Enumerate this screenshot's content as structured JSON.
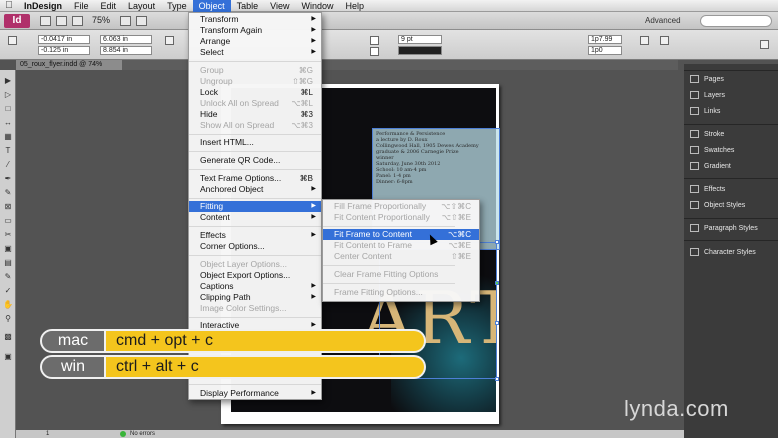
{
  "menubar": {
    "apple": "",
    "items": [
      "InDesign",
      "File",
      "Edit",
      "Layout",
      "Type",
      "Object",
      "Table",
      "View",
      "Window",
      "Help"
    ],
    "active": "Object"
  },
  "appbar": {
    "logo": "Id",
    "zoom": "75%",
    "workspace": "Advanced",
    "search_placeholder": ""
  },
  "control": {
    "x": "-0.0417 in",
    "y": "-0.125 in",
    "w": "6.063 in",
    "h": "8.854 in",
    "stroke": "9 pt",
    "ref": "1p0",
    "offset": "1p7.99"
  },
  "document": {
    "tab_title": "05_roux_flyer.indd @ 74%"
  },
  "object_menu": {
    "items": [
      {
        "label": "Transform",
        "shortcut": "",
        "submenu": true,
        "disabled": false
      },
      {
        "label": "Transform Again",
        "shortcut": "",
        "submenu": true,
        "disabled": false
      },
      {
        "label": "Arrange",
        "shortcut": "",
        "submenu": true,
        "disabled": false
      },
      {
        "label": "Select",
        "shortcut": "",
        "submenu": true,
        "disabled": false
      },
      {
        "label": "Group",
        "shortcut": "⌘G",
        "submenu": false,
        "disabled": true
      },
      {
        "label": "Ungroup",
        "shortcut": "⇧⌘G",
        "submenu": false,
        "disabled": true
      },
      {
        "label": "Lock",
        "shortcut": "⌘L",
        "submenu": false,
        "disabled": false
      },
      {
        "label": "Unlock All on Spread",
        "shortcut": "⌥⌘L",
        "submenu": false,
        "disabled": true
      },
      {
        "label": "Hide",
        "shortcut": "⌘3",
        "submenu": false,
        "disabled": false
      },
      {
        "label": "Show All on Spread",
        "shortcut": "⌥⌘3",
        "submenu": false,
        "disabled": true
      },
      {
        "label": "Insert HTML...",
        "shortcut": "",
        "submenu": false,
        "disabled": false
      },
      {
        "label": "Generate QR Code...",
        "shortcut": "",
        "submenu": false,
        "disabled": false
      },
      {
        "label": "Text Frame Options...",
        "shortcut": "⌘B",
        "submenu": false,
        "disabled": false
      },
      {
        "label": "Anchored Object",
        "shortcut": "",
        "submenu": true,
        "disabled": false
      },
      {
        "label": "Fitting",
        "shortcut": "",
        "submenu": true,
        "disabled": false,
        "highlight": true
      },
      {
        "label": "Content",
        "shortcut": "",
        "submenu": true,
        "disabled": false
      },
      {
        "label": "Effects",
        "shortcut": "",
        "submenu": true,
        "disabled": false
      },
      {
        "label": "Corner Options...",
        "shortcut": "",
        "submenu": false,
        "disabled": false
      },
      {
        "label": "Object Layer Options...",
        "shortcut": "",
        "submenu": false,
        "disabled": true
      },
      {
        "label": "Object Export Options...",
        "shortcut": "",
        "submenu": false,
        "disabled": false
      },
      {
        "label": "Captions",
        "shortcut": "",
        "submenu": true,
        "disabled": false
      },
      {
        "label": "Clipping Path",
        "shortcut": "",
        "submenu": true,
        "disabled": false
      },
      {
        "label": "Image Color Settings...",
        "shortcut": "",
        "submenu": false,
        "disabled": true
      },
      {
        "label": "Interactive",
        "shortcut": "",
        "submenu": true,
        "disabled": false
      },
      {
        "label": "Display Performance",
        "shortcut": "",
        "submenu": true,
        "disabled": false
      }
    ]
  },
  "fitting_submenu": {
    "items": [
      {
        "label": "Fill Frame Proportionally",
        "shortcut": "⌥⇧⌘C",
        "disabled": true
      },
      {
        "label": "Fit Content Proportionally",
        "shortcut": "⌥⇧⌘E",
        "disabled": true
      },
      {
        "label": "Fit Frame to Content",
        "shortcut": "⌥⌘C",
        "disabled": false,
        "highlight": true
      },
      {
        "label": "Fit Content to Frame",
        "shortcut": "⌥⌘E",
        "disabled": true
      },
      {
        "label": "Center Content",
        "shortcut": "⇧⌘E",
        "disabled": true
      },
      {
        "label": "Clear Frame Fitting Options",
        "shortcut": "",
        "disabled": true
      },
      {
        "label": "Frame Fitting Options...",
        "shortcut": "",
        "disabled": true
      }
    ]
  },
  "panels": {
    "items": [
      "Pages",
      "Layers",
      "Links",
      "Stroke",
      "Swatches",
      "Gradient",
      "Effects",
      "Object Styles",
      "Paragraph Styles",
      "Character Styles"
    ]
  },
  "poster": {
    "text_frame_body": "Performance & Persistence\na lecture by D. Roux\nCollingwood Hall, 1905 Dewes Academy\ngraduate & 2006 Carnegie Prize\nwinner\nSaturday, June 30th 2012\nSchool: 10 am-4 pm\nPanel: 1-4 pm\nDinner: 6-8pm",
    "headline": "ART"
  },
  "overlay": {
    "mac_label": "mac",
    "mac_keys": "cmd + opt + c",
    "win_label": "win",
    "win_keys": "ctrl + alt + c"
  },
  "status": {
    "page": "1",
    "errors": "No errors"
  },
  "watermark": "lynda.com",
  "colors": {
    "highlight": "#3470d8",
    "overlay_keys": "#f4c51d"
  }
}
